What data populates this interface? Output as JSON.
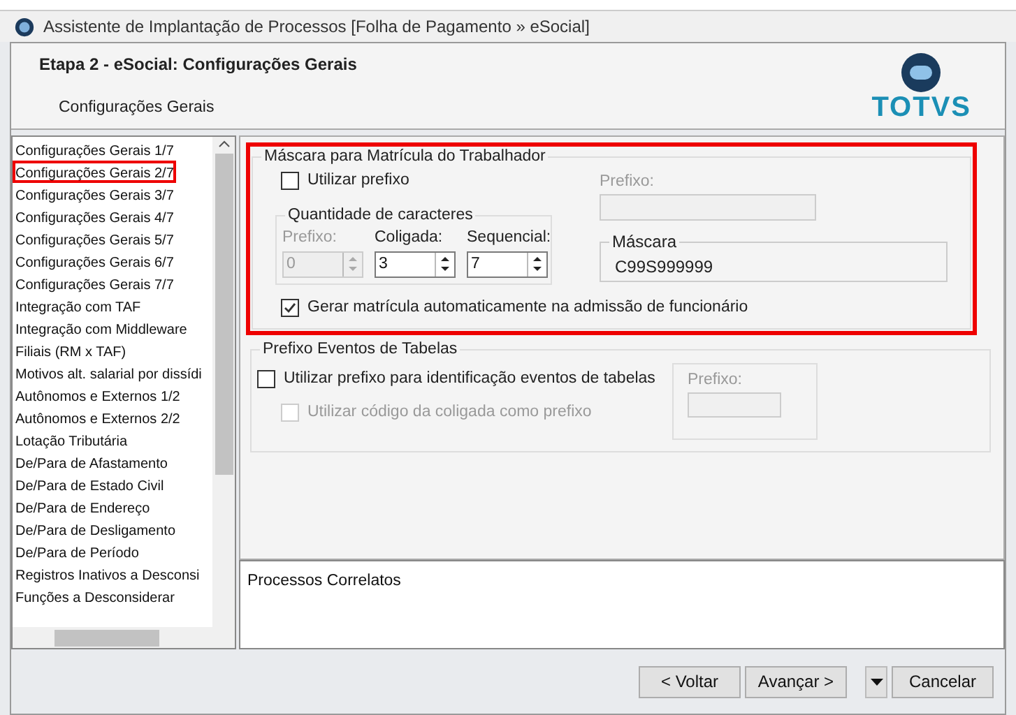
{
  "window": {
    "title": "Assistente de Implantação de Processos [Folha de Pagamento » eSocial]"
  },
  "header": {
    "title": "Etapa 2 - eSocial: Configurações Gerais",
    "subtitle": "Configurações Gerais",
    "logo": "TOTVS"
  },
  "steps": [
    {
      "label": "Configurações Gerais 1/7",
      "selected": false
    },
    {
      "label": "Configurações Gerais 2/7",
      "selected": true
    },
    {
      "label": "Configurações Gerais 3/7",
      "selected": false
    },
    {
      "label": "Configurações Gerais 4/7",
      "selected": false
    },
    {
      "label": "Configurações Gerais 5/7",
      "selected": false
    },
    {
      "label": "Configurações Gerais 6/7",
      "selected": false
    },
    {
      "label": "Configurações Gerais 7/7",
      "selected": false
    },
    {
      "label": "Integração com TAF",
      "selected": false
    },
    {
      "label": "Integração com Middleware",
      "selected": false
    },
    {
      "label": "Filiais (RM x TAF)",
      "selected": false
    },
    {
      "label": "Motivos alt. salarial por dissídi",
      "selected": false
    },
    {
      "label": "Autônomos e Externos 1/2",
      "selected": false
    },
    {
      "label": "Autônomos e Externos 2/2",
      "selected": false
    },
    {
      "label": "Lotação Tributária",
      "selected": false
    },
    {
      "label": "De/Para de Afastamento",
      "selected": false
    },
    {
      "label": "De/Para de Estado Civil",
      "selected": false
    },
    {
      "label": "De/Para de Endereço",
      "selected": false
    },
    {
      "label": "De/Para de Desligamento",
      "selected": false
    },
    {
      "label": "De/Para de Período",
      "selected": false
    },
    {
      "label": "Registros Inativos a Desconsi",
      "selected": false
    },
    {
      "label": "Funções a Desconsiderar",
      "selected": false
    }
  ],
  "mask_group": {
    "title": "Máscara para Matrícula do Trabalhador",
    "highlighted": true,
    "use_prefix": {
      "label": "Utilizar prefixo",
      "checked": false
    },
    "prefix_label": "Prefixo:",
    "quantity": {
      "title": "Quantidade de caracteres",
      "spinners": [
        {
          "label": "Prefixo:",
          "value": "0",
          "disabled": true
        },
        {
          "label": "Coligada:",
          "value": "3",
          "disabled": false
        },
        {
          "label": "Sequencial:",
          "value": "7",
          "disabled": false
        }
      ]
    },
    "mask": {
      "title": "Máscara",
      "value": "C99S999999"
    },
    "auto": {
      "label": "Gerar matrícula automaticamente na admissão de funcionário",
      "checked": true
    }
  },
  "events_group": {
    "title": "Prefixo Eventos de Tabelas",
    "options": [
      {
        "label": "Utilizar prefixo para identificação eventos de tabelas",
        "checked": false,
        "disabled": false
      },
      {
        "label": "Utilizar código da coligada como prefixo",
        "checked": false,
        "disabled": true
      }
    ],
    "prefix_label": "Prefixo:"
  },
  "related": {
    "title": "Processos Correlatos"
  },
  "buttons": [
    "< Voltar",
    "Avançar >",
    "Cancelar"
  ]
}
